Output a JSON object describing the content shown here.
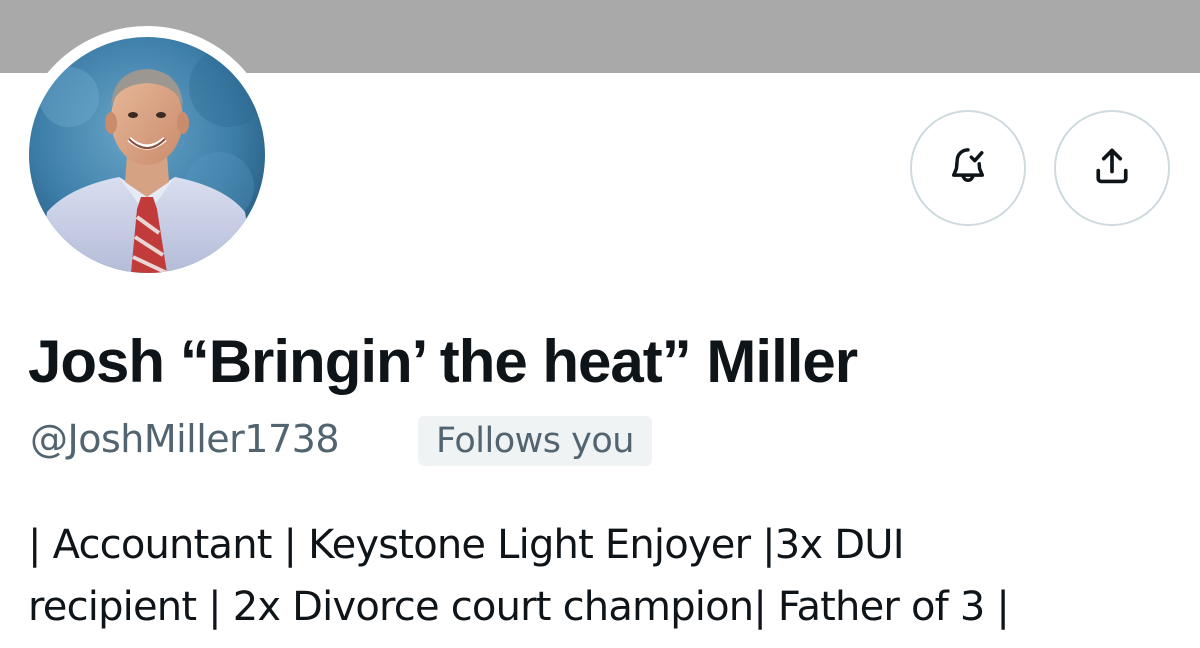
{
  "profile": {
    "display_name": "Josh “Bringin’ the heat” Miller",
    "handle": "@JoshMiller1738",
    "follows_you_badge": "Follows you",
    "bio_lines": [
      "| Accountant | Keystone Light Enjoyer |3x DUI",
      "recipient | 2x Divorce court champion| Father of 3 |"
    ]
  },
  "actions": {
    "notify_icon": "bell-check-icon",
    "share_icon": "share-upload-icon"
  },
  "colors": {
    "banner": "#a9a9a9",
    "text_primary": "#0f1419",
    "text_secondary": "#536471",
    "badge_bg": "#eff3f4",
    "button_border": "#cfd9de"
  }
}
